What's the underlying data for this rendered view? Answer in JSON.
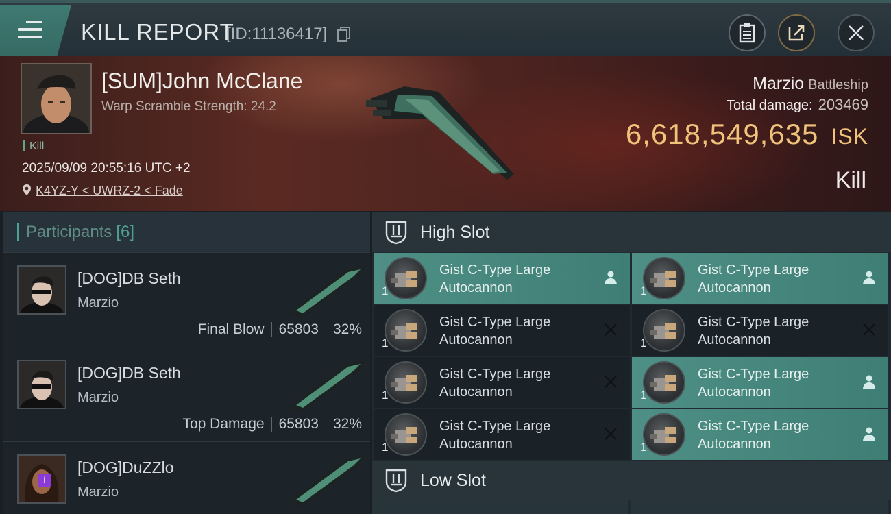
{
  "header": {
    "title": "KILL REPORT",
    "report_id": "[ID:11136417]",
    "icons": [
      "menu-icon",
      "copy-icon",
      "clipboard-icon",
      "share-icon",
      "close-icon"
    ]
  },
  "victim": {
    "name": "[SUM]John McClane",
    "scramble": "Warp Scramble Strength: 24.2",
    "tag": "Kill",
    "datetime": "2025/09/09 20:55:16 UTC +2",
    "location": "K4YZ-Y < UWRZ-2 < Fade",
    "ship_name": "Marzio",
    "ship_class": "Battleship",
    "total_damage_label": "Total damage:",
    "total_damage": "203469",
    "isk_value": "6,618,549,635",
    "isk_unit": "ISK",
    "result": "Kill"
  },
  "participants": {
    "title": "Participants",
    "count": "[6]",
    "rows": [
      {
        "name": "[DOG]DB Seth",
        "ship": "Marzio",
        "role": "Final Blow",
        "damage": "65803",
        "percent": "32%"
      },
      {
        "name": "[DOG]DB Seth",
        "ship": "Marzio",
        "role": "Top Damage",
        "damage": "65803",
        "percent": "32%"
      },
      {
        "name": "[DOG]DuZZlo",
        "ship": "Marzio",
        "badge": "i"
      }
    ]
  },
  "slots": {
    "high_label": "High Slot",
    "low_label": "Low Slot",
    "high": [
      {
        "line1": "Gist C-Type Large",
        "line2": "Autocannon",
        "qty": "1",
        "state": "fitted"
      },
      {
        "line1": "Gist C-Type Large",
        "line2": "Autocannon",
        "qty": "1",
        "state": "fitted"
      },
      {
        "line1": "Gist C-Type Large",
        "line2": "Autocannon",
        "qty": "1",
        "state": "destroyed"
      },
      {
        "line1": "Gist C-Type Large",
        "line2": "Autocannon",
        "qty": "1",
        "state": "destroyed"
      },
      {
        "line1": "Gist C-Type Large",
        "line2": "Autocannon",
        "qty": "1",
        "state": "destroyed"
      },
      {
        "line1": "Gist C-Type Large",
        "line2": "Autocannon",
        "qty": "1",
        "state": "fitted"
      },
      {
        "line1": "Gist C-Type Large",
        "line2": "Autocannon",
        "qty": "1",
        "state": "destroyed"
      },
      {
        "line1": "Gist C-Type Large",
        "line2": "Autocannon",
        "qty": "1",
        "state": "fitted"
      }
    ]
  },
  "colors": {
    "accent_teal": "#4e8f86",
    "isk_gold": "#f0c27a",
    "header_bg": "#243037"
  }
}
